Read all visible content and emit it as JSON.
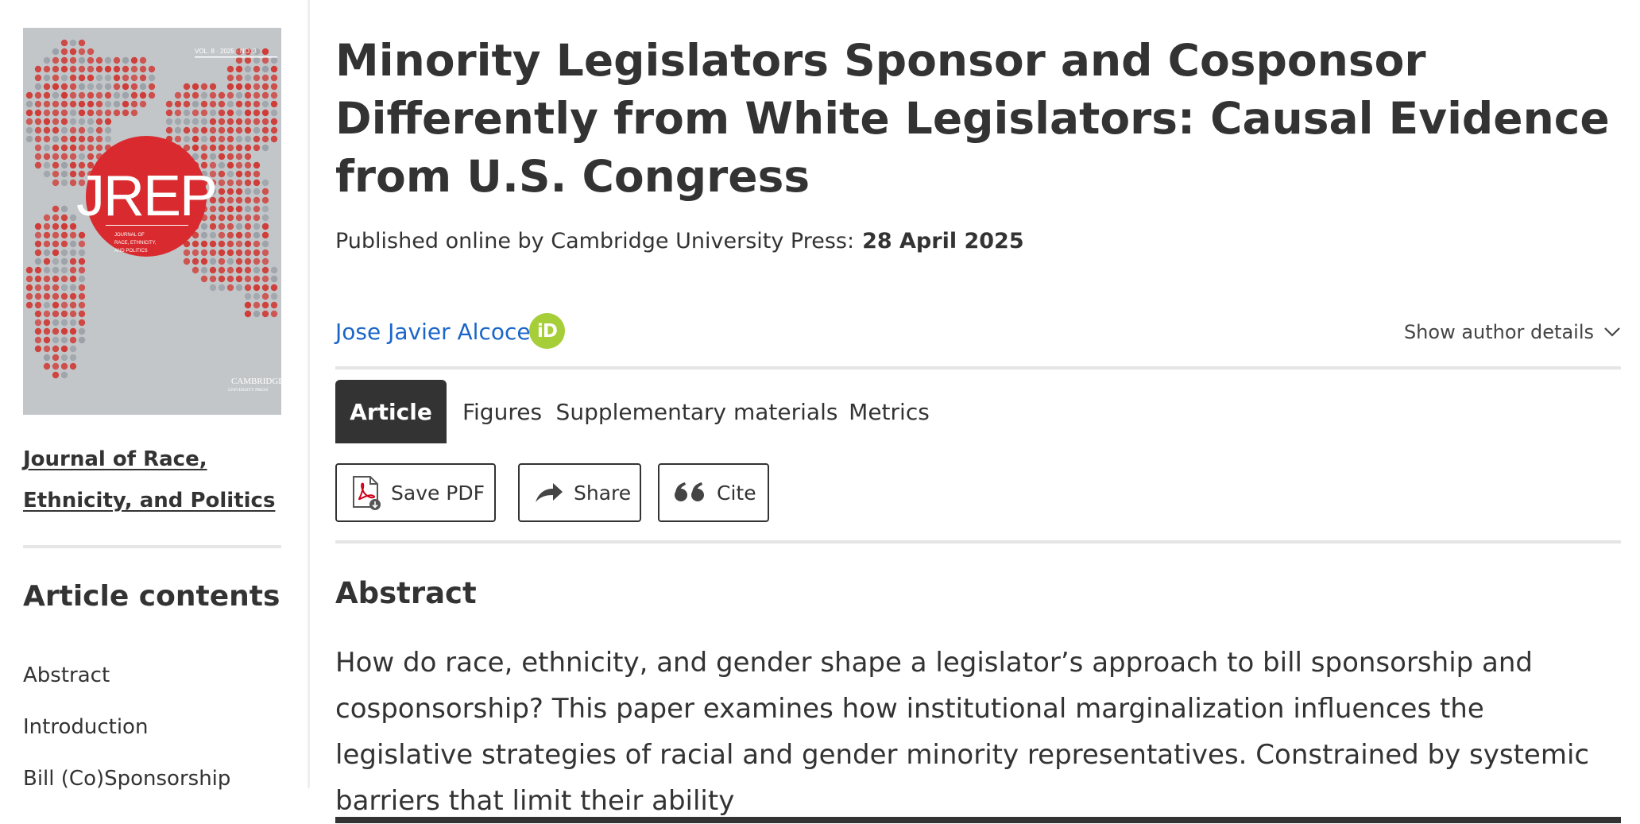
{
  "sidebar": {
    "cover": {
      "logo_text": "JREP",
      "volume_line": "VOL. 8 · 2025 · NO. 3",
      "subtitle_lines": [
        "JOURNAL OF",
        "RACE, ETHNICITY,",
        "AND POLITICS"
      ],
      "publisher_line1": "CAMBRIDGE",
      "publisher_line2": "UNIVERSITY PRESS",
      "colors": {
        "background": "#c3c6c9",
        "circle": "#d92b2f",
        "dots": "#cf3a35"
      }
    },
    "journal_name_line1": "Journal of Race,",
    "journal_name_line2": "Ethnicity, and Politics",
    "contents_heading": "Article contents",
    "contents": [
      {
        "label": "Abstract"
      },
      {
        "label": "Introduction"
      },
      {
        "label": "Bill (Co)Sponsorship"
      }
    ]
  },
  "article": {
    "title": "Minority Legislators Sponsor and Cosponsor Differently from White Legislators: Causal Evidence from U.S. Congress",
    "published_label": "Published online by Cambridge University Press:",
    "published_date": "28 April 2025",
    "author": "Jose Javier Alcocer",
    "orcid_label": "iD",
    "author_details_label": "Show author details",
    "tabs": [
      {
        "label": "Article",
        "active": true
      },
      {
        "label": "Figures",
        "active": false
      },
      {
        "label": "Supplementary materials",
        "active": false
      },
      {
        "label": "Metrics",
        "active": false
      }
    ],
    "actions": {
      "save_pdf": "Save PDF",
      "share": "Share",
      "cite": "Cite"
    },
    "abstract_heading": "Abstract",
    "abstract_text": "How do race, ethnicity, and gender shape a legislator’s approach to bill sponsorship and cosponsorship? This paper examines how institutional marginalization influences the legislative strategies of racial and gender minority representatives. Constrained by systemic barriers that limit their ability"
  },
  "colors": {
    "text": "#333333",
    "link": "#1a66c9",
    "orcid": "#a6ce39",
    "tab_active_bg": "#333333",
    "pdf_red": "#d0021b"
  }
}
